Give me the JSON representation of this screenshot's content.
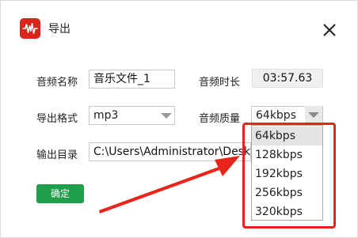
{
  "dialog": {
    "title": "导出",
    "ok_label": "确定"
  },
  "form": {
    "name_label": "音频名称",
    "name_value": "音乐文件_1",
    "duration_label": "音频时长",
    "duration_value": "03:57.63",
    "format_label": "导出格式",
    "format_value": "mp3",
    "quality_label": "音频质量",
    "quality_value": "64kbps",
    "dir_label": "输出目录",
    "dir_value": "C:\\Users\\Administrator\\Desktop"
  },
  "quality_options": [
    "64kbps",
    "128kbps",
    "192kbps",
    "256kbps",
    "320kbps"
  ],
  "colors": {
    "brand": "#d9251c",
    "ok_button": "#1e9f4a",
    "annotation": "#e8251b"
  },
  "icons": {
    "app": "audio-waveform-icon",
    "close": "close-icon",
    "dropdown": "chevron-down-icon"
  }
}
